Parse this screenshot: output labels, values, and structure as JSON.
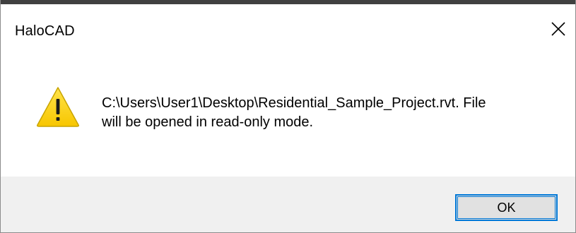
{
  "dialog": {
    "title": "HaloCAD",
    "message_line1": "C:\\Users\\User1\\Desktop\\Residential_Sample_Project.rvt. File",
    "message_line2": "will be opened in read-only mode.",
    "ok_label": "OK",
    "icons": {
      "warning": "warning-icon",
      "close": "close-icon"
    },
    "colors": {
      "warning_fill": "#FCD116",
      "warning_outline": "#C8A400",
      "button_border": "#0078D7",
      "footer_bg": "#F0F0F0"
    }
  }
}
